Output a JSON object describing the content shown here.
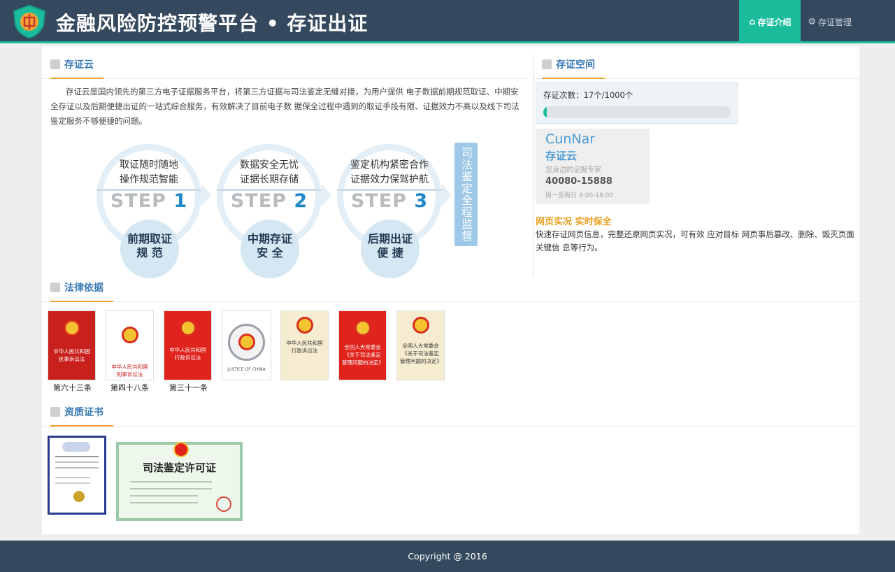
{
  "header": {
    "title": "金融风险防控预警平台 • 存证出证",
    "nav": [
      {
        "label": "存证介绍",
        "icon": "home-icon",
        "active": true
      },
      {
        "label": "存证管理",
        "icon": "gear-icon",
        "active": false
      }
    ]
  },
  "sections": {
    "cunzhengyun": "存证云",
    "space": "存证空间",
    "law": "法律依据",
    "cert": "资质证书"
  },
  "intro": "存证云是国内领先的第三方电子证据服务平台，将第三方证据与司法鉴定无缝对接，为用户提供 电子数据前期规范取证、中期安全存证以及后期便捷出证的一站式综合服务，有效解决了目前电子数 据保全过程中遇到的取证手段有限、证据效力不高以及线下司法鉴定服务不够便捷的问题。",
  "steps": [
    {
      "line1": "取证随时随地",
      "line2": "操作规范智能",
      "word": "STEP",
      "num": "1",
      "bottom1": "前期取证",
      "bottom2": "规 范"
    },
    {
      "line1": "数据安全无忧",
      "line2": "证据长期存储",
      "word": "STEP",
      "num": "2",
      "bottom1": "中期存证",
      "bottom2": "安 全"
    },
    {
      "line1": "鉴定机构紧密合作",
      "line2": "证据效力保驾护航",
      "word": "STEP",
      "num": "3",
      "bottom1": "后期出证",
      "bottom2": "便 捷"
    }
  ],
  "vertical_label": "司法鉴定全程监督",
  "space": {
    "count_text": "存证次数：17个/1000个",
    "used": 17,
    "total": 1000
  },
  "brand": {
    "name": "CunNar",
    "sub": "存证云",
    "tagline": "您身边的证据专家",
    "phone": "40080-15888",
    "hours": "周一至周日 9:00-18:00"
  },
  "web": {
    "title": "网页实况 实时保全",
    "desc": "快速存证网页信息，完整还原网页实况，可有效 应对目标 网页事后篡改、删除、毁灭页面关键信 息等行为。"
  },
  "law_books": [
    {
      "title": "中华人民共和国民事诉讼法",
      "label": "第六十三条"
    },
    {
      "title": "中华人民共和国刑事诉讼法",
      "label": "第四十八条"
    },
    {
      "title": "中华人民共和国行政诉讼法",
      "label": "第三十一条"
    },
    {
      "title": "JUSTICE OF CHINA",
      "label": ""
    },
    {
      "title": "中华人民共和国行政诉讼法",
      "label": ""
    },
    {
      "title": "全国人大常委会《关于司法鉴定管理问题的决定》",
      "label": ""
    },
    {
      "title": "全国人大常委会《关于司法鉴定管理问题的决定》",
      "label": ""
    }
  ],
  "certs": {
    "license_title": "司法鉴定许可证"
  },
  "footer": "Copyright @ 2016",
  "colors": {
    "header": "#34495e",
    "accent": "#1abc9c",
    "section_title": "#3a7ab5",
    "underline": "#f0a030",
    "highlight": "#e8a020"
  }
}
